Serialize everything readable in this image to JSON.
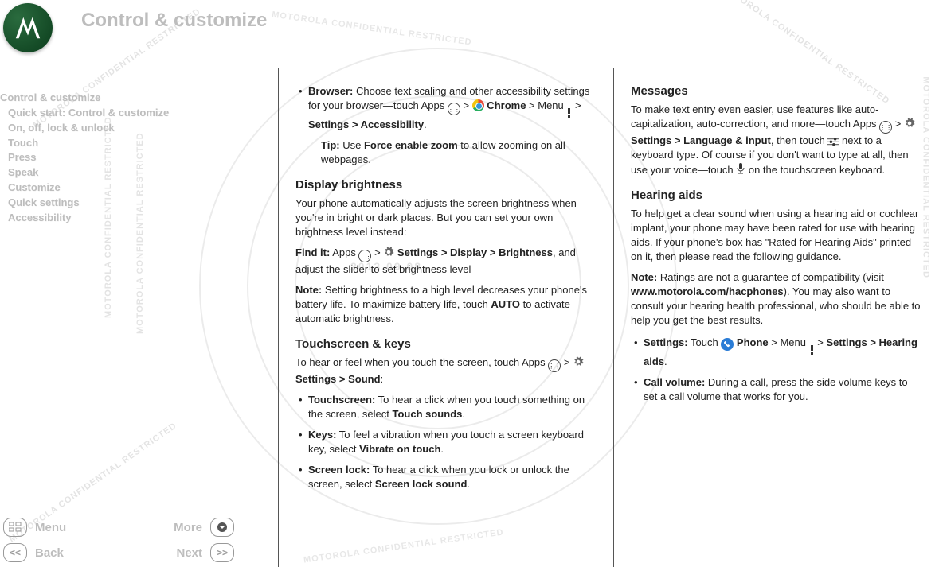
{
  "header": {
    "title": "Control & customize"
  },
  "sidebar": {
    "items": [
      "Control & customize",
      "Quick start: Control & customize",
      "On, off, lock & unlock",
      "Touch",
      "Press",
      "Speak",
      "Customize",
      "Quick settings",
      "Accessibility"
    ]
  },
  "nav": {
    "menu": "Menu",
    "more": "More",
    "back": "Back",
    "next": "Next",
    "back_sym": "<<",
    "next_sym": ">>"
  },
  "watermark": {
    "text": "MOTOROLA CONFIDENTIAL RESTRICTED",
    "date": "2013.09.08"
  },
  "col1": {
    "browser_label": "Browser:",
    "browser_text1": " Choose text scaling and other accessibility settings for your browser—touch Apps ",
    "browser_text2": " Chrome ",
    "browser_text3": " Menu ",
    "browser_path": "Settings > Accessibility",
    "tip_label": "Tip:",
    "tip_text1": " Use ",
    "tip_bold": "Force enable zoom",
    "tip_text2": " to allow zooming on all webpages.",
    "h_display": "Display brightness",
    "display_p": "Your phone automatically adjusts the screen brightness when you're in bright or dark places. But you can set your own brightness level instead:",
    "findit_label": "Find it:",
    "findit_text1": " Apps ",
    "findit_path": "Settings > Display > Brightness",
    "findit_text2": ", and adjust the slider to set brightness level",
    "note_label": "Note:",
    "note_text": " Setting brightness to a high level decreases your phone's battery life. To maximize battery life, touch ",
    "note_bold": "AUTO",
    "note_text2": " to activate automatic brightness.",
    "h_touch": "Touchscreen & keys",
    "touch_p1": "To hear or feel when you touch the screen, touch Apps ",
    "touch_path": "Settings > Sound",
    "li_ts_label": "Touchscreen:",
    "li_ts_text": " To hear a click when you touch something on the screen, select ",
    "li_ts_bold": "Touch sounds",
    "li_keys_label": "Keys:",
    "li_keys_text": " To feel a vibration when you touch a screen keyboard key, select ",
    "li_keys_bold": "Vibrate on touch",
    "li_lock_label": "Screen lock:",
    "li_lock_text": " To hear a click when you lock or unlock the screen, select ",
    "li_lock_bold": "Screen lock sound"
  },
  "col2": {
    "h_messages": "Messages",
    "msg_p1": "To make text entry even easier, use features like auto-capitalization, auto-correction, and more—touch Apps ",
    "msg_path": "Settings > Language & input",
    "msg_p2": ", then touch ",
    "msg_p3": " next to a keyboard type. Of course if you don't want to type at all, then use your voice—touch ",
    "msg_p4": " on the touchscreen keyboard.",
    "h_hearing": "Hearing aids",
    "hear_p": "To help get a clear sound when using a hearing aid or cochlear implant, your phone may have been rated for use with hearing aids. If your phone's box has \"Rated for Hearing Aids\" printed on it, then please read the following guidance.",
    "hear_note_label": "Note:",
    "hear_note1": " Ratings are not a guarantee of compatibility (visit ",
    "hear_note_url": "www.motorola.com/hacphones",
    "hear_note2": "). You may also want to consult your hearing health professional, who should be able to help you get the best results.",
    "li_set_label": "Settings:",
    "li_set_text1": " Touch ",
    "li_set_phone": " Phone",
    "li_set_text2": " > Menu ",
    "li_set_path": "Settings > Hearing aids",
    "li_vol_label": "Call volume:",
    "li_vol_text": " During a call, press the side volume keys to set a call volume that works for you."
  }
}
